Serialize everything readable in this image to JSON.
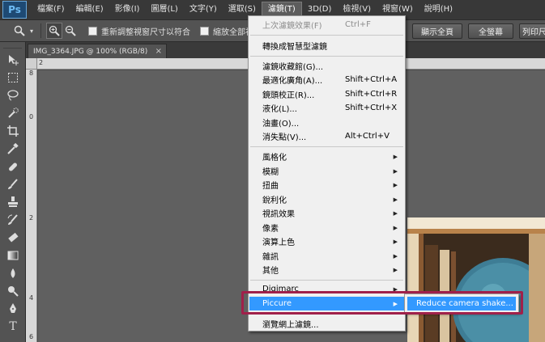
{
  "app": {
    "logo": "Ps"
  },
  "menubar": {
    "items": [
      {
        "label": "檔案(F)"
      },
      {
        "label": "編輯(E)"
      },
      {
        "label": "影像(I)"
      },
      {
        "label": "圖層(L)"
      },
      {
        "label": "文字(Y)"
      },
      {
        "label": "選取(S)"
      },
      {
        "label": "濾鏡(T)"
      },
      {
        "label": "3D(D)"
      },
      {
        "label": "檢視(V)"
      },
      {
        "label": "視窗(W)"
      },
      {
        "label": "說明(H)"
      }
    ]
  },
  "options": {
    "resize_windows_label": "重新調整視窗尺寸以符合",
    "zoom_all_label": "縮放全部視窗",
    "fit_screen_label": "顯示全頁",
    "fill_screen_label": "全螢幕",
    "print_size_label": "列印尺寸"
  },
  "document": {
    "tab_title": "IMG_3364.JPG @ 100% (RGB/8)",
    "close_glyph": "×"
  },
  "rulers": {
    "left_numbers": [
      "8",
      "0",
      "2",
      "4",
      "6"
    ],
    "top_numbers": [
      "2"
    ]
  },
  "filter_menu": {
    "last_filter": {
      "label": "上次濾鏡效果(F)",
      "shortcut": "Ctrl+F"
    },
    "convert_smart": {
      "label": "轉換成智慧型濾鏡"
    },
    "group1": [
      {
        "label": "濾鏡收藏館(G)...",
        "shortcut": ""
      },
      {
        "label": "最適化廣角(A)...",
        "shortcut": "Shift+Ctrl+A"
      },
      {
        "label": "鏡頭校正(R)...",
        "shortcut": "Shift+Ctrl+R"
      },
      {
        "label": "液化(L)...",
        "shortcut": "Shift+Ctrl+X"
      },
      {
        "label": "油畫(O)...",
        "shortcut": ""
      },
      {
        "label": "消失點(V)...",
        "shortcut": "Alt+Ctrl+V"
      }
    ],
    "group2": [
      {
        "label": "風格化"
      },
      {
        "label": "模糊"
      },
      {
        "label": "扭曲"
      },
      {
        "label": "銳利化"
      },
      {
        "label": "視訊效果"
      },
      {
        "label": "像素"
      },
      {
        "label": "演算上色"
      },
      {
        "label": "雜訊"
      },
      {
        "label": "其他"
      }
    ],
    "group3": [
      {
        "label": "Digimarc"
      },
      {
        "label": "Piccure"
      }
    ],
    "browse_online": {
      "label": "瀏覽網上濾鏡..."
    },
    "submenu_arrow": "▶"
  },
  "submenu": {
    "item": "Reduce camera shake..."
  },
  "colors": {
    "highlight": "#3399ff",
    "annotation": "#a0204a"
  }
}
